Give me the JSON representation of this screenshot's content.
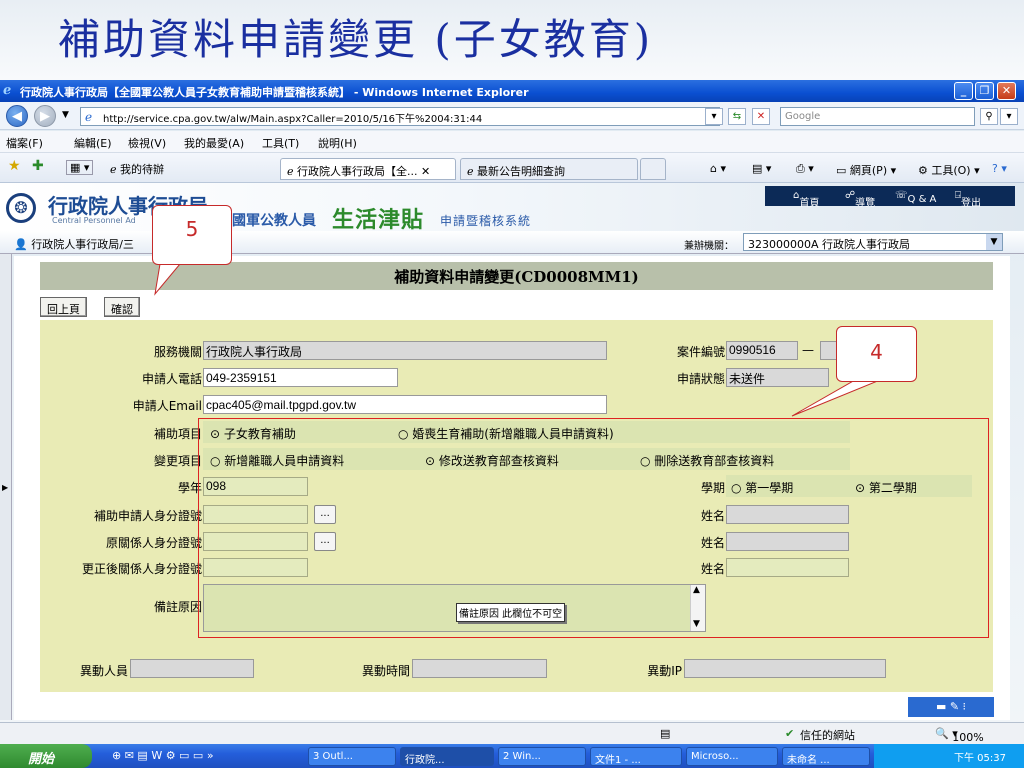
{
  "slide_title": "補助資料申請變更 (子女教育)",
  "window": {
    "title": "行政院人事行政局【全國軍公教人員子女教育補助申請暨稽核系統】 - Windows Internet Explorer",
    "url": "http://service.cpa.gov.tw/alw/Main.aspx?Caller=2010/5/16下午%2004:31:44",
    "search_placeholder": "Google"
  },
  "menu": [
    "檔案(F)",
    "編輯(E)",
    "檢視(V)",
    "我的最愛(A)",
    "工具(T)",
    "說明(H)"
  ],
  "favorites": {
    "item": "我的待辦",
    "tabs": [
      "行政院人事行政局【全...",
      "最新公告明細查詢"
    ],
    "right": [
      "網頁(P)",
      "工具(O)"
    ]
  },
  "app": {
    "org_name": "行政院人事行政局",
    "org_en": "Central Personnel Ad",
    "sys_part1": "國軍公教人員",
    "sys_part2": "生活津貼",
    "sys_part3": "申請暨稽核系統",
    "links": [
      "首頁",
      "導覽",
      "Q & A",
      "登出"
    ],
    "breadcrumb": "行政院人事行政局/三",
    "agency_label": "兼辦機關：",
    "agency_value": "323000000A 行政院人事行政局"
  },
  "form": {
    "title": "補助資料申請變更(CD0008MM1)",
    "back_button": "回上頁",
    "confirm_button": "確認",
    "service_agency_label": "服務機關",
    "service_agency_value": "行政院人事行政局",
    "phone_label": "申請人電話",
    "phone_value": "049-2359151",
    "email_label": "申請人Email",
    "email_value": "cpac405@mail.tpgpd.gov.tw",
    "case_no_label": "案件編號",
    "case_no_value": "0990516",
    "case_no_sep": "—",
    "status_label": "申請狀態",
    "status_value": "未送件",
    "subsidy_label": "補助項目",
    "subsidy_options": [
      "子女教育補助",
      "婚喪生育補助(新增離職人員申請資料)"
    ],
    "change_label": "變更項目",
    "change_options": [
      "新增離職人員申請資料",
      "修改送教育部查核資料",
      "刪除送教育部查核資料"
    ],
    "year_label": "學年",
    "year_value": "098",
    "term_label": "學期",
    "term_options": [
      "第一學期",
      "第二學期"
    ],
    "applicant_id_label": "補助申請人身分證號",
    "orig_id_label": "原關係人身分證號",
    "new_id_label": "更正後關係人身分證號",
    "name_label": "姓名",
    "memo_label": "備註原因",
    "memo_tip": "備註原因 此欄位不可空",
    "dots": "...",
    "operator_label": "異動人員",
    "time_label": "異動時間",
    "ip_label": "異動IP"
  },
  "callouts": [
    "5",
    "4"
  ],
  "status": {
    "zone": "信任的網站",
    "zoom": "100%"
  },
  "taskbar": {
    "start": "開始",
    "items": [
      "3 Outl...",
      "行政院...",
      "2 Win...",
      "文件1 - ...",
      "Microso...",
      "未命名 ..."
    ],
    "time": "下午 05:37"
  }
}
